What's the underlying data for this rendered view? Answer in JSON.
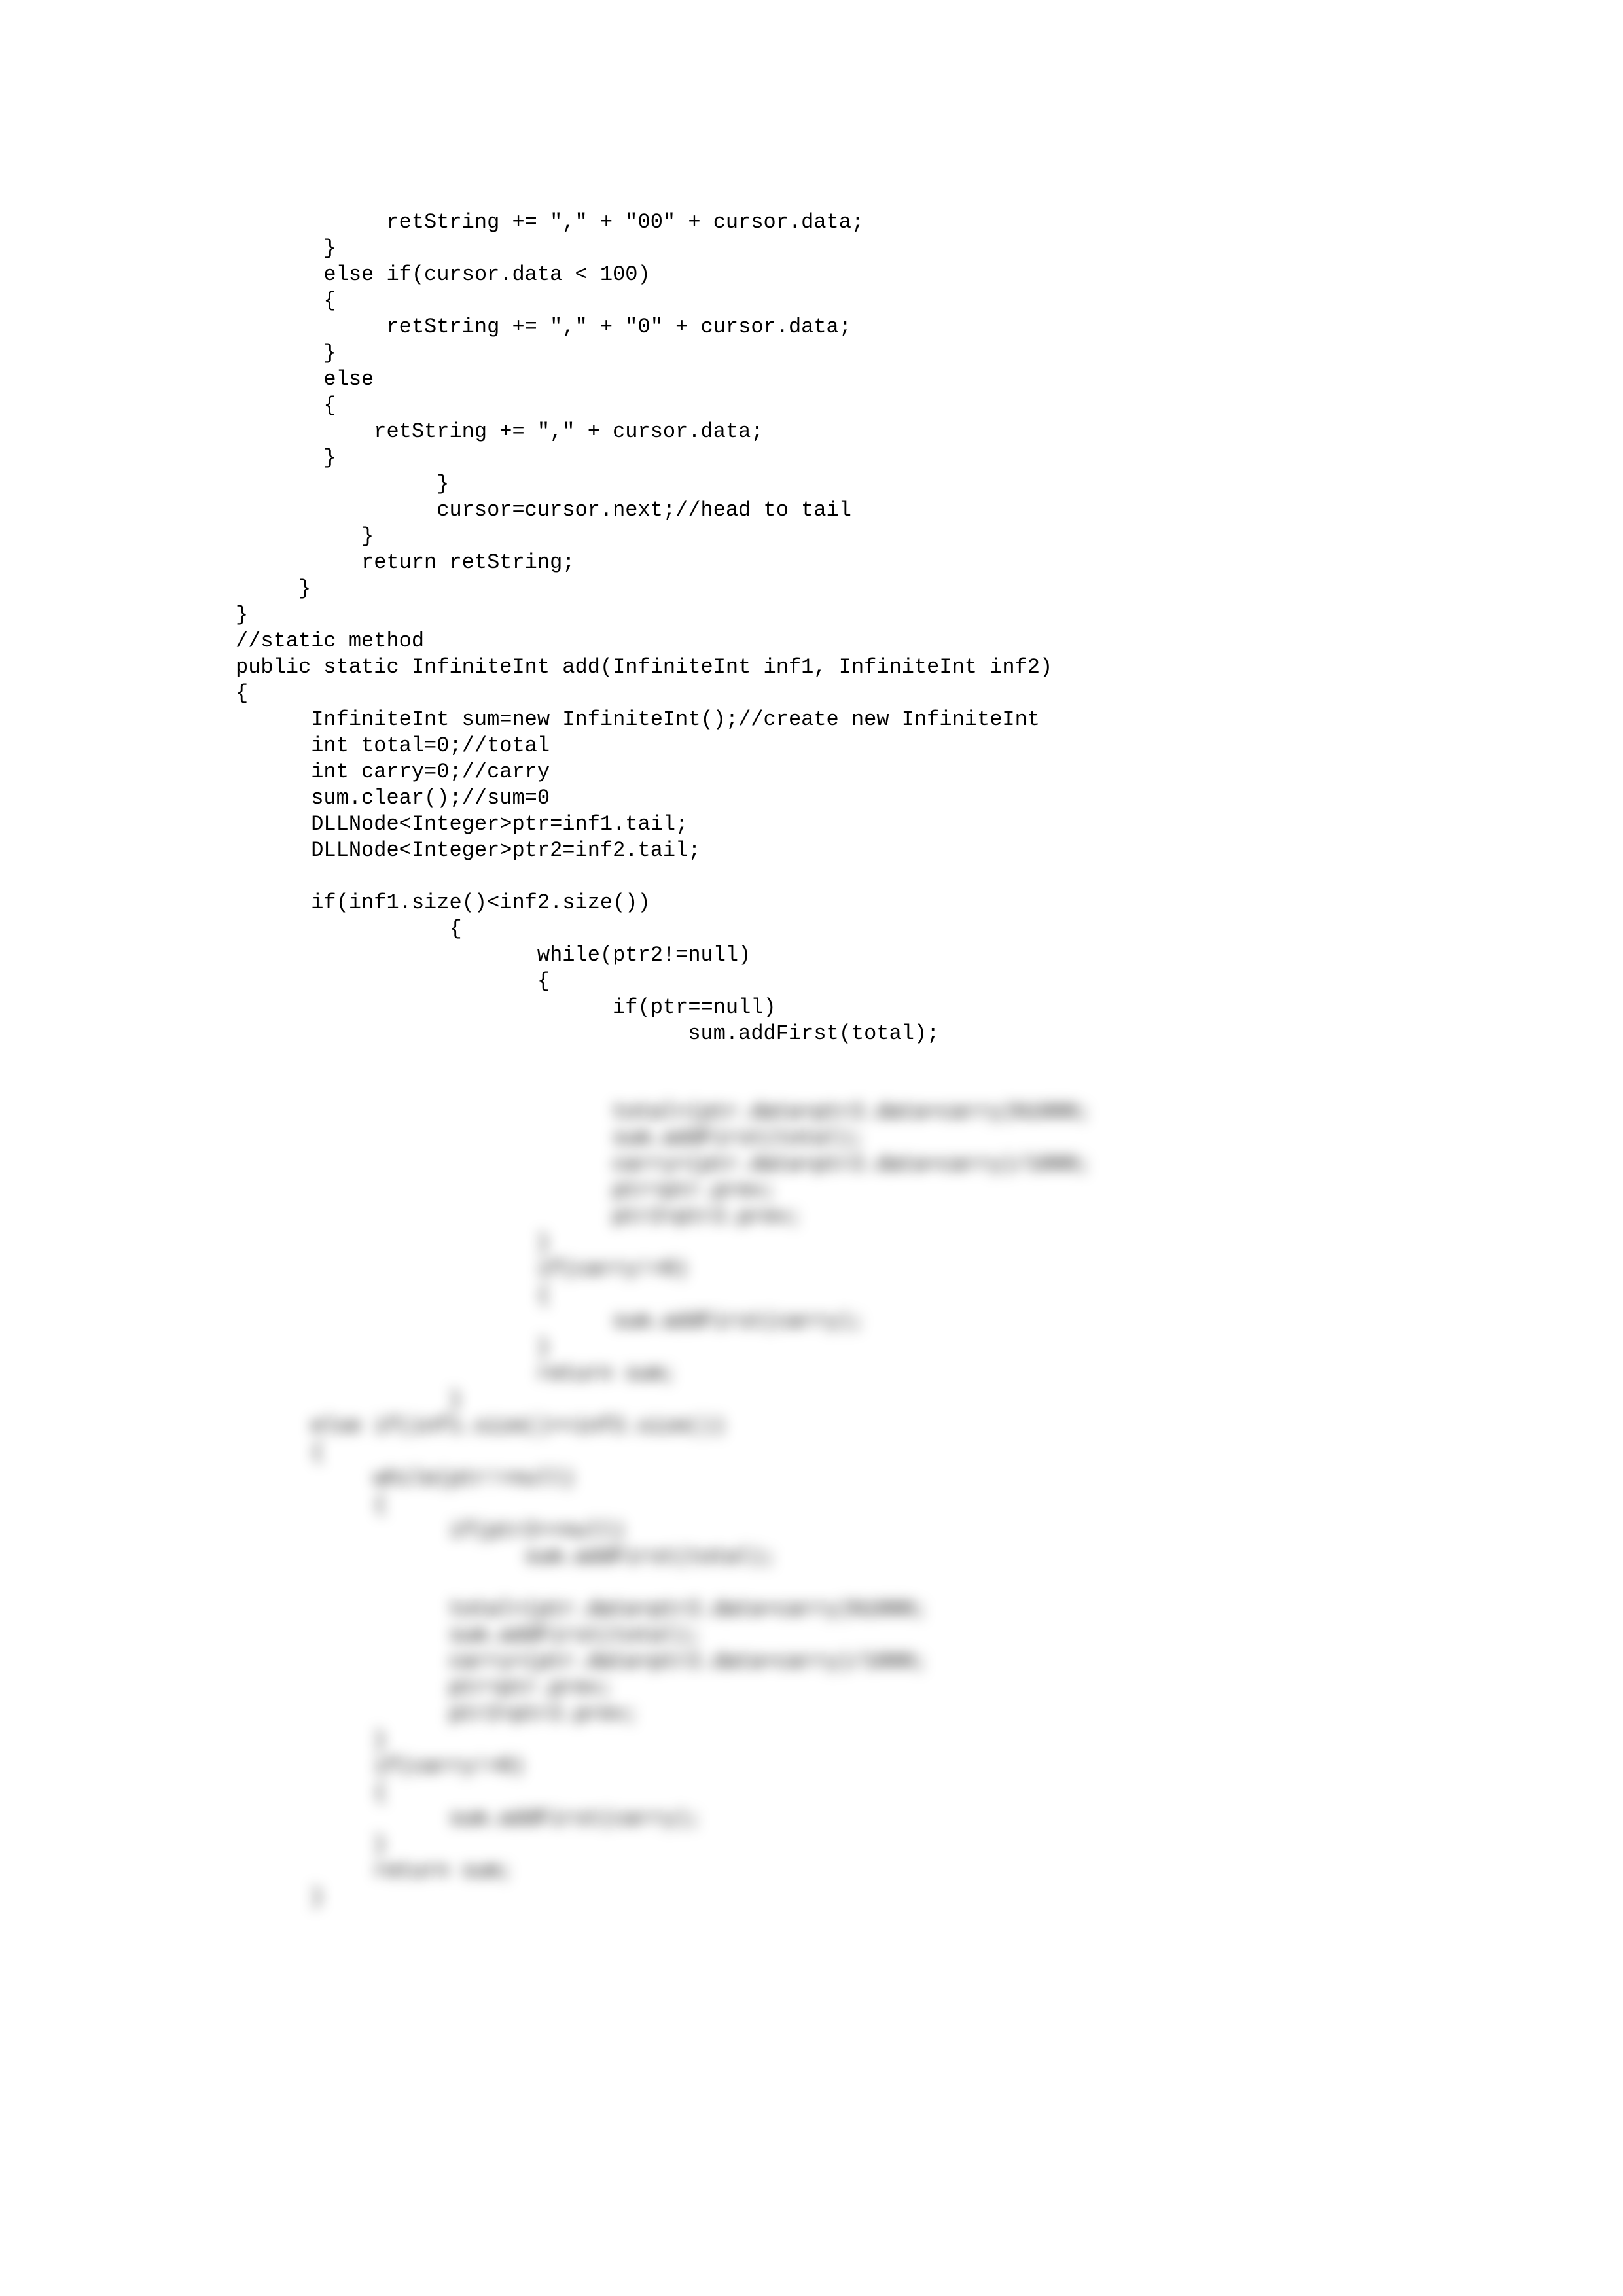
{
  "code": {
    "clear_lines": [
      "            retString += \",\" + \"00\" + cursor.data;",
      "       }",
      "       else if(cursor.data < 100)",
      "       {",
      "            retString += \",\" + \"0\" + cursor.data;",
      "       }",
      "       else",
      "       {",
      "           retString += \",\" + cursor.data;",
      "       }",
      "                }",
      "                cursor=cursor.next;//head to tail",
      "          }",
      "          return retString;",
      "     }",
      "}",
      "//static method",
      "public static InfiniteInt add(InfiniteInt inf1, InfiniteInt inf2)",
      "{",
      "      InfiniteInt sum=new InfiniteInt();//create new InfiniteInt",
      "      int total=0;//total",
      "      int carry=0;//carry",
      "      sum.clear();//sum=0",
      "      DLLNode<Integer>ptr=inf1.tail;",
      "      DLLNode<Integer>ptr2=inf2.tail;",
      "",
      "      if(inf1.size()<inf2.size())",
      "                 {",
      "                        while(ptr2!=null)",
      "                        {",
      "                              if(ptr==null)",
      "                                    sum.addFirst(total);"
    ],
    "blurred_lines": [
      "",
      "                              total=(ptr.data+ptr2.data+carry)%1000;",
      "                              sum.addFirst(total);",
      "                              carry=(ptr.data+ptr2.data+carry)/1000;",
      "                              ptr=ptr.prev;",
      "                              ptr2=ptr2.prev;",
      "                        }",
      "                        if(carry!=0)",
      "                        {",
      "                              sum.addFirst(carry);",
      "                        }",
      "                        return sum;",
      "                 }",
      "      else if(inf1.size()>=inf2.size())",
      "      {",
      "           while(ptr!=null)",
      "           {",
      "                 if(ptr2==null)",
      "                       sum.addFirst(total);",
      "",
      "                 total=(ptr.data+ptr2.data+carry)%1000;",
      "                 sum.addFirst(total);",
      "                 carry=(ptr.data+ptr2.data+carry)/1000;",
      "                 ptr=ptr.prev;",
      "                 ptr2=ptr2.prev;",
      "           }",
      "           if(carry!=0)",
      "           {",
      "                 sum.addFirst(carry);",
      "           }",
      "           return sum;",
      "      }"
    ]
  }
}
